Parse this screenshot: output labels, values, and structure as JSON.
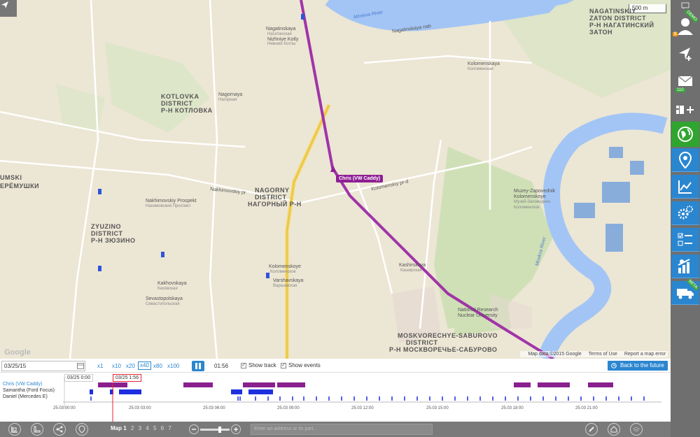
{
  "map": {
    "scale": "500 m",
    "car_label": "Chris (VW Caddy)",
    "footer": {
      "data": "Map data ©2015 Google",
      "terms": "Terms of Use",
      "report": "Report a map error"
    },
    "google": "Google",
    "labels": [
      {
        "t": "Moskva River",
        "c": "river"
      },
      {
        "t": "Nagatinskaya",
        "c": ""
      },
      {
        "t": "Нагатинская",
        "c": "small"
      },
      {
        "t": "Nizhniye Kotly",
        "c": ""
      },
      {
        "t": "Нижние Котлы",
        "c": "small"
      },
      {
        "t": "Nagatinskaya nab",
        "c": ""
      },
      {
        "t": "NAGATINSKIY",
        "c": "big"
      },
      {
        "t": "ZATON DISTRICT",
        "c": "big"
      },
      {
        "t": "Р-Н НАГАТИНСКИЙ",
        "c": "big"
      },
      {
        "t": "ЗАТОН",
        "c": "big"
      },
      {
        "t": "KOTLOVKA",
        "c": "big"
      },
      {
        "t": "DISTRICT",
        "c": "big"
      },
      {
        "t": "Р-Н КОТЛОВКА",
        "c": "big"
      },
      {
        "t": "Nagornaya",
        "c": ""
      },
      {
        "t": "Нагорная",
        "c": "small"
      },
      {
        "t": "Kolomenskaya",
        "c": ""
      },
      {
        "t": "Коломенская",
        "c": "small"
      },
      {
        "t": "Nakhimovskiy Prospekt",
        "c": ""
      },
      {
        "t": "Нахимовский Проспект",
        "c": "small"
      },
      {
        "t": "NAGORNY",
        "c": "big"
      },
      {
        "t": "DISTRICT",
        "c": "big"
      },
      {
        "t": "НАГОРНЫЙ Р-Н",
        "c": "big"
      },
      {
        "t": "Kolomenskoye",
        "c": ""
      },
      {
        "t": "Коломенское",
        "c": "small"
      },
      {
        "t": "Varshavskaya",
        "c": ""
      },
      {
        "t": "Варшавская",
        "c": "small"
      },
      {
        "t": "Kashirskaya",
        "c": ""
      },
      {
        "t": "Каширская",
        "c": "small"
      },
      {
        "t": "ZYUZINO",
        "c": "big"
      },
      {
        "t": "DISTRICT",
        "c": "big"
      },
      {
        "t": "Р-Н ЗЮЗИНО",
        "c": "big"
      },
      {
        "t": "Kakhovskaya",
        "c": ""
      },
      {
        "t": "Каховская",
        "c": "small"
      },
      {
        "t": "Sevastopolskaya",
        "c": ""
      },
      {
        "t": "Севастопольская",
        "c": "small"
      },
      {
        "t": "National Research",
        "c": ""
      },
      {
        "t": "Nuclear University",
        "c": ""
      },
      {
        "t": "MOSKVORECHYE-SABUROVO",
        "c": "big"
      },
      {
        "t": "DISTRICT",
        "c": "big"
      },
      {
        "t": "Р-Н МОСКВОРЕЧЬЕ-САБУРОВО",
        "c": "big"
      },
      {
        "t": "Muzey-Zapovednik",
        "c": ""
      },
      {
        "t": "Kolomenskoye",
        "c": ""
      },
      {
        "t": "Музей-Заповедник",
        "c": "small"
      },
      {
        "t": "Коломенское",
        "c": "small"
      },
      {
        "t": "Moskva River",
        "c": "river"
      },
      {
        "t": "Kolomenskiy pr-d",
        "c": ""
      },
      {
        "t": "Nakhimovskiy pr",
        "c": ""
      },
      {
        "t": "UMSKI",
        "c": "big"
      },
      {
        "t": "ЕРЁМУШКИ",
        "c": "big"
      }
    ]
  },
  "sidebar": {
    "badges": {
      "money": "$",
      "mail": "110",
      "demo": "DEMO",
      "beta": "BETA"
    }
  },
  "panel": {
    "date": "03/25/15",
    "speeds": [
      "x1",
      "x10",
      "x20",
      "x40",
      "x80",
      "x100"
    ],
    "active_speed": "x40",
    "time": "01:56",
    "show_track": "Show track",
    "show_events": "Show events",
    "back_to_future": "Back to the future",
    "timeline": {
      "names": [
        "Chris (VW Caddy)",
        "Samantha (Ford Focus)",
        "Daniel (Mercedes E)"
      ],
      "marker_start": "03/25 0:00",
      "marker_current": "03/25 1:56",
      "ticks": [
        "25.03 00:00",
        "25.03 03:00",
        "25.03 06:00",
        "25.03 09:00",
        "25.03 12:00",
        "25.03 15:00",
        "25.03 18:00",
        "25.03 21:00"
      ]
    },
    "bottom": {
      "map_label": "Map 1",
      "map_pages": [
        "2",
        "3",
        "4",
        "5",
        "6",
        "7"
      ],
      "address_placeholder": "Enter an address or its part..."
    }
  }
}
